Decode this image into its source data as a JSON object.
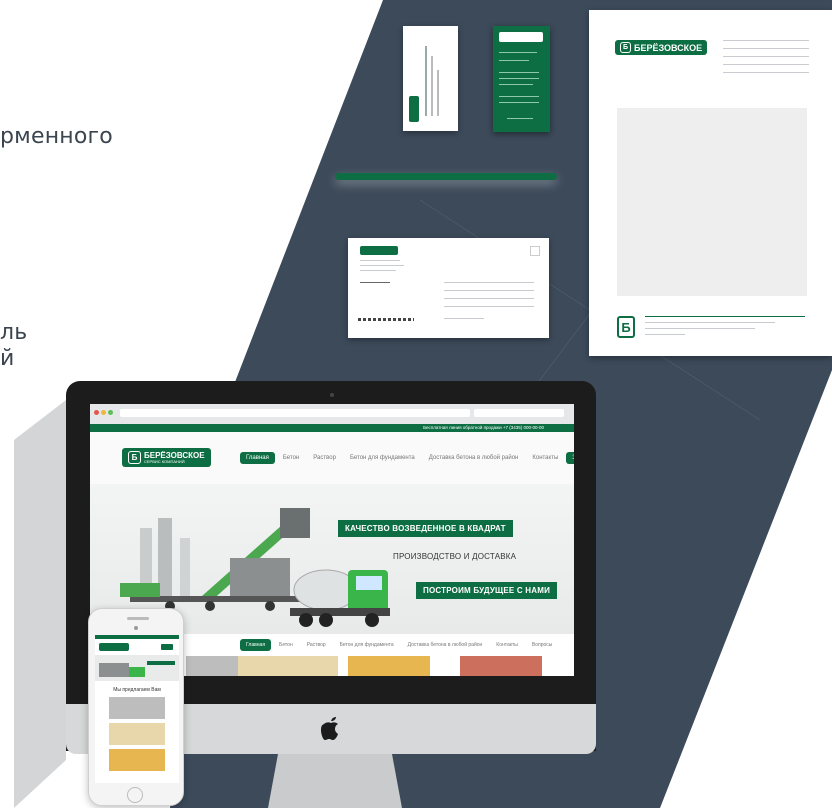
{
  "left_fragments": {
    "line1": "рменного",
    "line2": "ль",
    "line3": "й"
  },
  "brand": {
    "name": "БЕРЁЗОВСКОЕ",
    "tagline": "СЕРВИС КОМПАНИЙ",
    "mark": "Б",
    "green": "#0e6e43",
    "dark_slate": "#3c4a5a"
  },
  "site": {
    "topbar_text": "Бесплатная линия обратной продажи   +7 (3435) 000-00-00",
    "nav": [
      {
        "label": "Главная",
        "active": true
      },
      {
        "label": "Бетон",
        "active": false
      },
      {
        "label": "Раствор",
        "active": false
      },
      {
        "label": "Бетон для фундамента",
        "active": false
      },
      {
        "label": "Доставка бетона в любой район",
        "active": false
      },
      {
        "label": "Контакты",
        "active": false
      },
      {
        "label": "Заказать",
        "active": true
      }
    ],
    "slogans": {
      "s1": "КАЧЕСТВО ВОЗВЕДЕННОЕ В КВАДРАТ",
      "s2": "ПРОИЗВОДСТВО И ДОСТАВКА",
      "s3": "ПОСТРОИМ БУДУЩЕЕ С НАМИ"
    },
    "subnav": [
      "Главная",
      "Бетон",
      "Раствор",
      "Бетон для фундамента",
      "Доставка бетона в любой район",
      "Контакты",
      "Вопросы"
    ]
  },
  "phone": {
    "title": "Мы предлагаем Вам"
  }
}
